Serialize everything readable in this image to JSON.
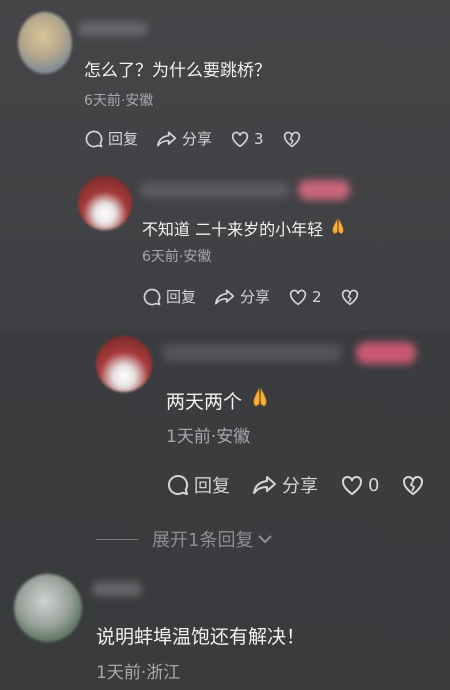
{
  "comments": [
    {
      "text": "怎么了？为什么要跳桥？",
      "meta": "6天前·安徽",
      "actions": {
        "reply": "回复",
        "share": "分享",
        "likes": "3"
      }
    },
    {
      "text": "不知道 二十来岁的小年轻",
      "meta": "6天前·安徽",
      "actions": {
        "reply": "回复",
        "share": "分享",
        "likes": "2"
      }
    },
    {
      "text": "两天两个",
      "meta": "1天前·安徽",
      "actions": {
        "reply": "回复",
        "share": "分享",
        "likes": "0"
      }
    },
    {
      "text": "说明蚌埠温饱还有解决！",
      "meta": "1天前·浙江"
    }
  ],
  "expand_replies": "展开1条回复",
  "icons": [
    "reply-icon",
    "share-icon",
    "heart-icon",
    "broken-heart-icon",
    "pray-emoji-icon",
    "chevron-down-icon"
  ],
  "colors": {
    "text": "#f2f2f2",
    "meta": "#a7a8ab",
    "accent_blur": "#d86a80"
  }
}
